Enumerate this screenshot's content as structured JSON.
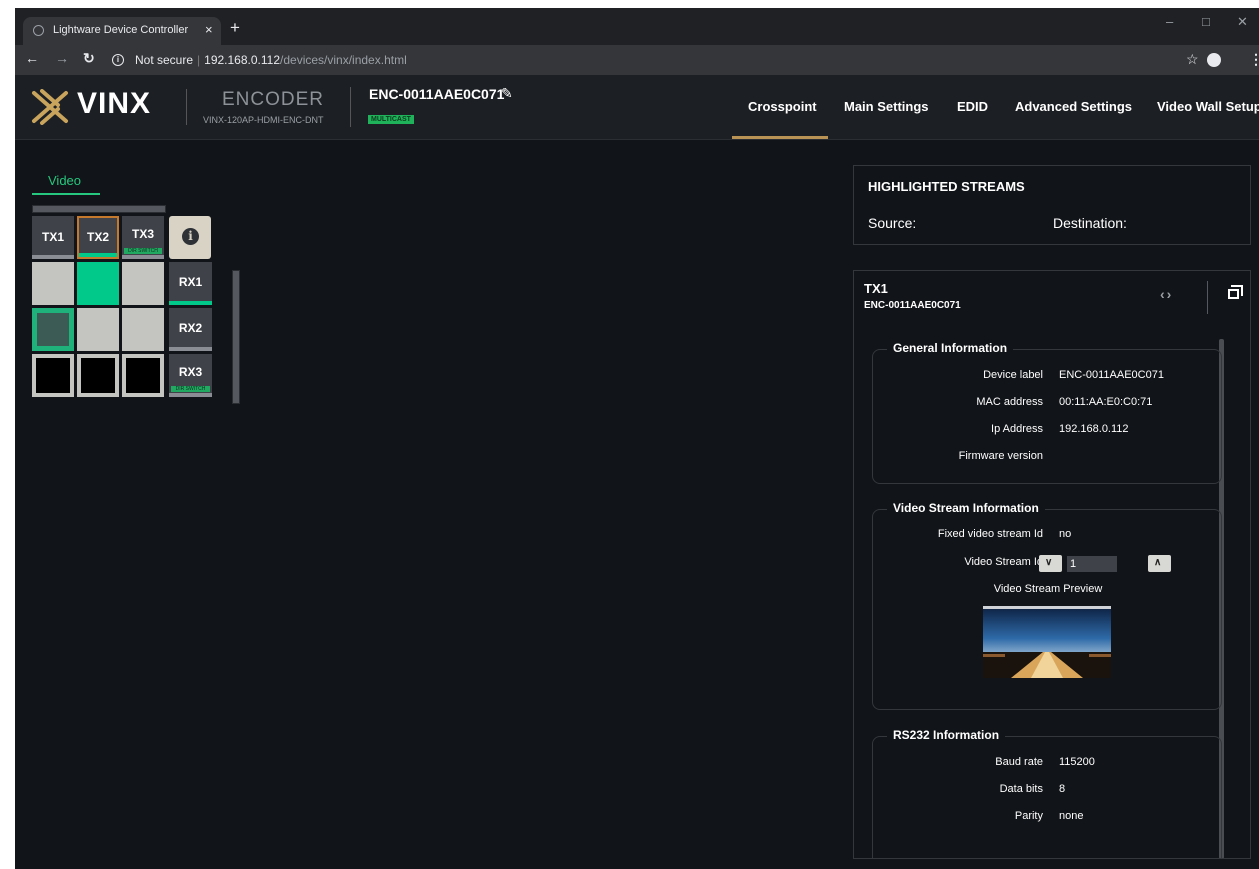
{
  "browser": {
    "tab_title": "Lightware Device Controller",
    "tab_close": "×",
    "new_tab": "+",
    "security_label": "Not secure",
    "url_host": "192.168.0.112",
    "url_path": "/devices/vinx/index.html"
  },
  "header": {
    "logo_text": "VINX",
    "device_type": "ENCODER",
    "model": "VINX-120AP-HDMI-ENC-DNT",
    "device_id": "ENC-0011AAE0C071",
    "badge": "MULTICAST",
    "nav": [
      "Crosspoint",
      "Main Settings",
      "EDID",
      "Advanced Settings",
      "Video Wall Setup"
    ],
    "active_nav": "Crosspoint"
  },
  "crosspoint": {
    "tab": "Video",
    "transmitters": [
      "TX1",
      "TX2",
      "TX3"
    ],
    "receivers": [
      "RX1",
      "RX2",
      "RX3"
    ],
    "switch_badge": "DIR SWITCH",
    "connections": [
      [
        "off",
        "on",
        "off"
      ],
      [
        "selected",
        "off",
        "off"
      ],
      [
        "dark",
        "dark",
        "dark"
      ]
    ],
    "colors": {
      "active": "#00c98a",
      "accent": "#b99356"
    }
  },
  "highlighted": {
    "title": "HIGHLIGHTED STREAMS",
    "source_label": "Source:",
    "destination_label": "Destination:"
  },
  "details": {
    "name": "TX1",
    "id": "ENC-0011AAE0C071",
    "general": {
      "title": "General Information",
      "rows": [
        {
          "label": "Device label",
          "value": "ENC-0011AAE0C071"
        },
        {
          "label": "MAC address",
          "value": "00:11:AA:E0:C0:71"
        },
        {
          "label": "Ip Address",
          "value": "192.168.0.112"
        },
        {
          "label": "Firmware version",
          "value": ""
        }
      ]
    },
    "video": {
      "title": "Video Stream Information",
      "fixed_label": "Fixed video stream Id",
      "fixed_value": "no",
      "id_label": "Video Stream Id",
      "id_value": "1",
      "preview_label": "Video Stream Preview"
    },
    "rs232": {
      "title": "RS232 Information",
      "rows": [
        {
          "label": "Baud rate",
          "value": "115200"
        },
        {
          "label": "Data bits",
          "value": "8"
        },
        {
          "label": "Parity",
          "value": "none"
        }
      ]
    }
  }
}
